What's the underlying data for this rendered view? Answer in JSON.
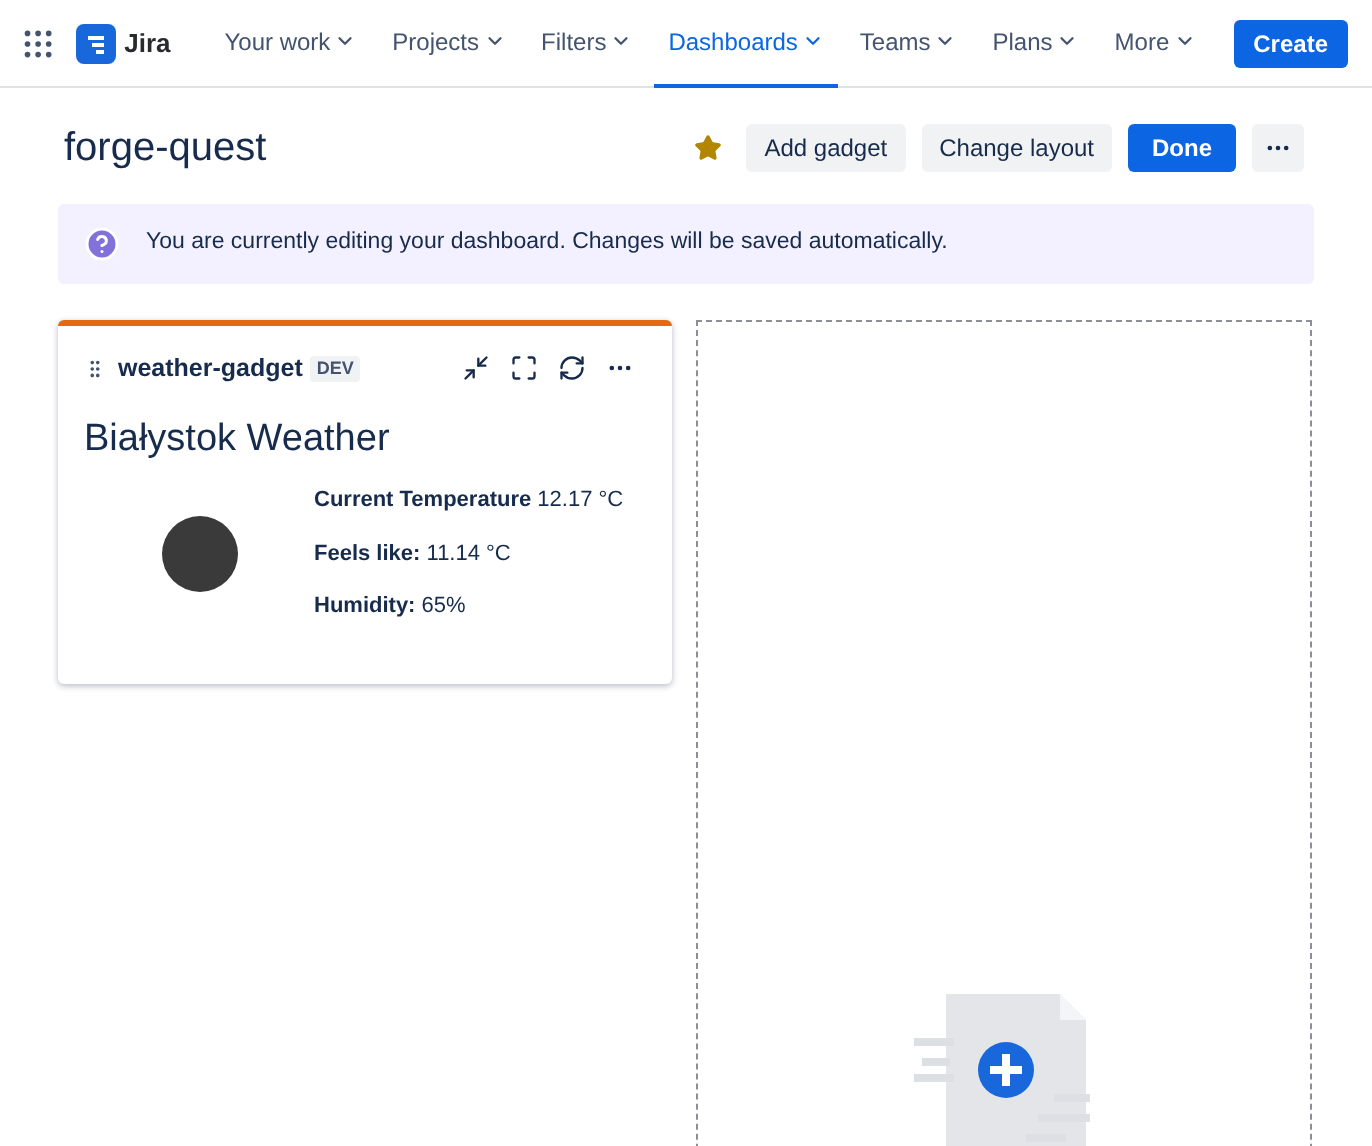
{
  "nav": {
    "product": "Jira",
    "items": [
      {
        "label": "Your work",
        "selected": false
      },
      {
        "label": "Projects",
        "selected": false
      },
      {
        "label": "Filters",
        "selected": false
      },
      {
        "label": "Dashboards",
        "selected": true
      },
      {
        "label": "Teams",
        "selected": false
      },
      {
        "label": "Plans",
        "selected": false
      },
      {
        "label": "More",
        "selected": false
      }
    ],
    "create": "Create"
  },
  "header": {
    "title": "forge-quest",
    "starred": true,
    "buttons": [
      {
        "label": "Add gadget",
        "kind": "default"
      },
      {
        "label": "Change layout",
        "kind": "default"
      },
      {
        "label": "Done",
        "kind": "primary"
      },
      {
        "kind": "more"
      }
    ]
  },
  "banner": {
    "text": "You are currently editing your dashboard. Changes will be saved automatically."
  },
  "gadget": {
    "name": "weather-gadget",
    "badge": "DEV",
    "heading": "Białystok Weather",
    "rows": [
      {
        "label": "Current Temperature",
        "value": "12.17 °C"
      },
      {
        "label": "Feels like:",
        "value": "11.14 °C"
      },
      {
        "label": "Humidity:",
        "value": "65%"
      }
    ]
  }
}
